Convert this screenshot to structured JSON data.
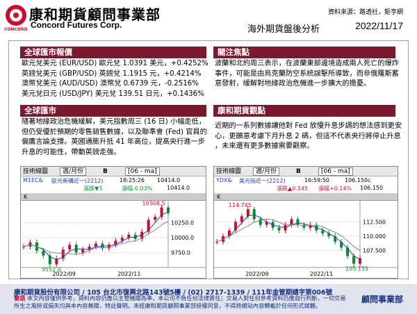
{
  "header": {
    "logo_cn": "康和期貨顧問事業部",
    "logo_en": "Concord Futures Corp.",
    "logo_small": "CONCORD",
    "source": "資料來源：路透社，鉅亨網",
    "subtitle": "海外期貨盤後分析",
    "date": "2022/11/17"
  },
  "sections": {
    "fx": {
      "title": "全球匯市報價",
      "lines": [
        "歐元兌美元 (EUR/USD)  歐元兌 1.0391 美元，+0.4252%",
        "英鎊兌美元 (GBP/USD) 英鎊兌 1.1915 元，+0.4214%",
        "澳幣兌美元 (AUD/USD) 澳幣兌 0.6739 元，-0.2516%",
        "美元兌日元 (USD/JPY) 美元兌 139.51 日元，+0.1436%"
      ]
    },
    "focus": {
      "title": "關注焦點",
      "lines": [
        "波蘭和北約周三表示，在波蘭東部邊境造成兩人死亡的爆炸",
        "事件，可能是由烏克蘭防空系統誤擊所導致，而非俄羅斯蓄",
        "意發射，緩解對地緣政治危機進一步擴大的擔憂。"
      ]
    },
    "market": {
      "title": "全球匯市",
      "lines": [
        "隨著地緣政治危機緩解，美元指數周三 (16 日) 小幅走低，",
        "但仍受優於預期的零售銷售數據，以及聯準會 (Fed) 官員的",
        "偏鷹言論支撐。英國通膨升抵 41 年高位，提高央行進一步",
        "升息的可能性，帶動英鎊走強。"
      ]
    },
    "view": {
      "title": "康和期貨觀點",
      "lines": [
        "近期的一系列數據讓他對 Fed 放慢升息步調的想法感到更安",
        "心，更願意考慮下月升息 2 碼，但這不代表央行將停止升息",
        "，未來還有更多數據需要觀察。"
      ]
    }
  },
  "charts": [
    {
      "toolbar_label": "技術線圖",
      "period": "週/月份",
      "contract": "[06 - ma]",
      "symbol": "M1EC&",
      "name": "歐元新構近一(2212)",
      "time": "18:25:26",
      "price": "10414.0",
      "change_label": "漲跌▼3",
      "change_pct": "漲幅-0.03%",
      "last": "10414.0",
      "k_label": "K",
      "high_label": "10508.5",
      "low_label": "9552.0",
      "y_ticks": [
        "10250.0",
        "10000.0",
        "9750.0"
      ],
      "x_ticks": [
        "2022/09",
        "2022/11"
      ]
    },
    {
      "toolbar_label": "技術線圖",
      "period": "週/月份",
      "contract": "[06 - ma]",
      "symbol": "YDX&",
      "name": "美元指近一(2212)",
      "time": "16:59:50",
      "price": "106.150c",
      "change_label": "漲跌▲0.145",
      "change_pct": "漲幅+0.14%",
      "last": "106.150",
      "k_label": "K",
      "high_label": "114.745",
      "low_label": "105.155",
      "y_ticks": [
        "112.500",
        "110.000",
        "107.500"
      ],
      "x_ticks": [
        "2022/09",
        "2022/11"
      ]
    }
  ],
  "chart_data": [
    {
      "type": "line",
      "title": "歐元新構近一(2212)",
      "x": [
        "2022/09",
        "2022/11"
      ],
      "series": [
        {
          "name": "close",
          "values": [
            9850,
            9920,
            9780,
            9700,
            9552,
            9650,
            9800,
            9880,
            9750,
            9800,
            9850,
            9900,
            9820,
            9880,
            9950,
            10000,
            10050,
            9980,
            10100,
            10300,
            10350,
            10508.5,
            10414
          ]
        }
      ],
      "ylim": [
        9500,
        10550
      ]
    },
    {
      "type": "line",
      "title": "美元指近一(2212)",
      "x": [
        "2022/09",
        "2022/11"
      ],
      "series": [
        {
          "name": "close",
          "values": [
            109,
            110,
            111,
            112.5,
            113.5,
            114.745,
            113,
            112,
            112.5,
            111.5,
            111,
            112,
            113,
            112,
            111.5,
            112,
            111,
            110.5,
            110,
            109,
            108,
            106.5,
            105.155,
            106.15
          ]
        }
      ],
      "ylim": [
        104.5,
        115.5
      ]
    }
  ],
  "footer": {
    "company": "康和期貨股份有限公司 / 105 台北市復興北路143號5樓 / (02) 2717-1339 / 111年金管期總字第006號",
    "warning_label": "警語",
    "warning": "本文內容僅供參考，資料內容仍應以主管機關為準，本公司不負任何法律責任；交易人對任何參考資料仍應自行判斷，一切交易所生之風險或損失均與本內容無關，特此聲明。未經康和期貨顧問事業部授權同意，不得將網站內容轉載於任何形式媒體。",
    "brand": "顧問事業部"
  }
}
